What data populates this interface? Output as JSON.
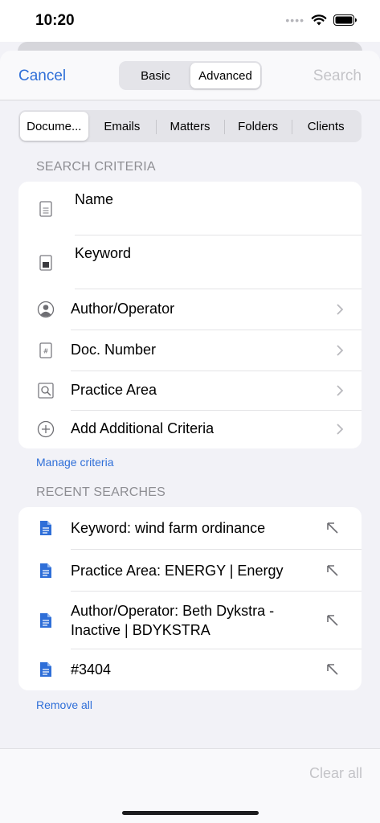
{
  "status": {
    "time": "10:20"
  },
  "nav": {
    "cancel": "Cancel",
    "search": "Search",
    "modes": [
      "Basic",
      "Advanced"
    ],
    "active_mode": "Advanced"
  },
  "tabs": [
    "Docume...",
    "Emails",
    "Matters",
    "Folders",
    "Clients"
  ],
  "search_criteria": {
    "title": "SEARCH CRITERIA",
    "fields": [
      {
        "label": "Name",
        "icon": "document-icon"
      },
      {
        "label": "Keyword",
        "icon": "document-filled-icon"
      }
    ],
    "rows": [
      {
        "label": "Author/Operator",
        "icon": "person-icon"
      },
      {
        "label": "Doc. Number",
        "icon": "hash-document-icon"
      },
      {
        "label": "Practice Area",
        "icon": "magnifier-document-icon"
      },
      {
        "label": "Add Additional Criteria",
        "icon": "plus-circle-icon"
      }
    ],
    "manage": "Manage criteria"
  },
  "recent_searches": {
    "title": "RECENT SEARCHES",
    "items": [
      {
        "line1": "Keyword: wind farm ordinance",
        "line2": ""
      },
      {
        "line1": "Practice Area: ENERGY | Energy",
        "line2": ""
      },
      {
        "line1": "Author/Operator: Beth Dykstra -",
        "line2": "Inactive | BDYKSTRA"
      },
      {
        "line1": "#3404",
        "line2": ""
      }
    ],
    "remove_all": "Remove all"
  },
  "footer": {
    "clear_all": "Clear all"
  },
  "colors": {
    "accent": "#2f6fd8",
    "doc_icon": "#2f6fd8",
    "disabled": "#c4c4c8"
  }
}
